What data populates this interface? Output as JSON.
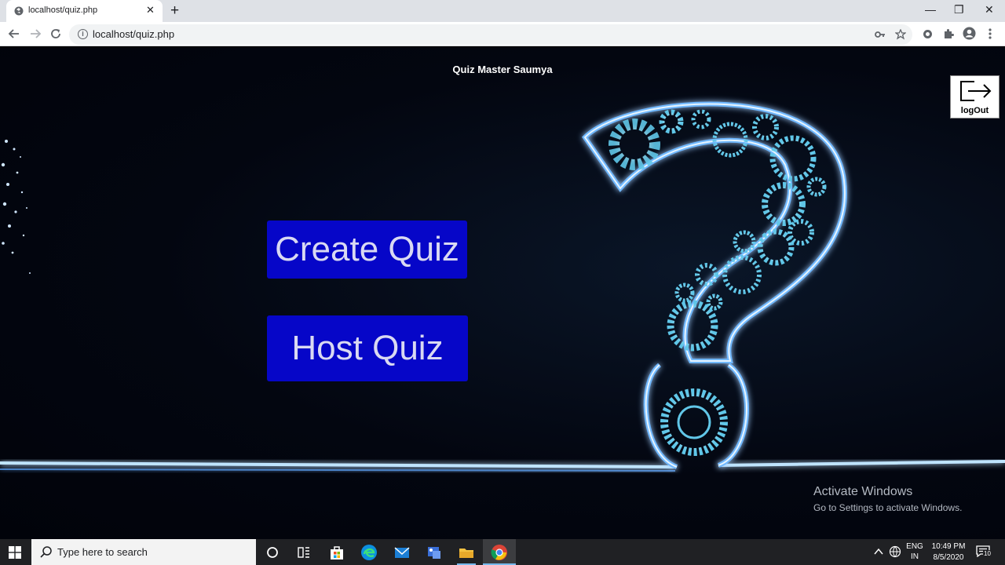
{
  "browser": {
    "tab_title": "localhost/quiz.php",
    "tab_close": "✕",
    "new_tab": "+",
    "url": "localhost/quiz.php",
    "win_min": "—",
    "win_restore": "❐",
    "win_close": "✕"
  },
  "page": {
    "title": "Quiz Master Saumya",
    "logout_label": "logOut",
    "create_quiz": "Create Quiz",
    "host_quiz": "Host Quiz",
    "activate_title": "Activate Windows",
    "activate_sub": "Go to Settings to activate Windows."
  },
  "taskbar": {
    "search_placeholder": "Type here to search",
    "lang_top": "ENG",
    "lang_bottom": "IN",
    "time": "10:49 PM",
    "date": "8/5/2020",
    "notification_count": "10"
  },
  "icons": [
    "tab-favicon-icon",
    "back-icon",
    "forward-icon",
    "reload-icon",
    "info-icon",
    "key-icon",
    "star-icon",
    "extension-icon",
    "profile-icon",
    "menu-icon",
    "logout-arrow-icon",
    "windows-start-icon",
    "search-icon",
    "cortana-icon",
    "task-view-icon",
    "store-icon",
    "edge-icon",
    "mail-icon",
    "app-icon",
    "file-explorer-icon",
    "chrome-icon",
    "chevron-up-icon",
    "network-icon",
    "notification-icon"
  ]
}
